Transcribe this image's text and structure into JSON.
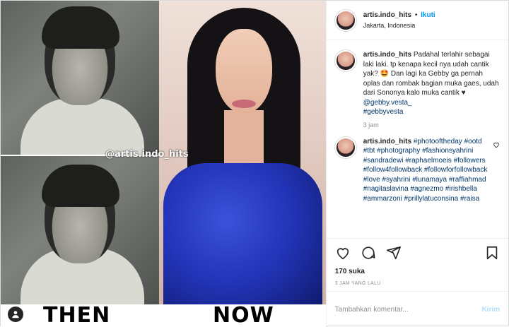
{
  "media": {
    "watermark": "@artis.indo_hits",
    "then_label": "THEN",
    "now_label": "NOW",
    "user_tag_icon": "person-icon"
  },
  "header": {
    "username": "artis.indo_hits",
    "separator": "•",
    "follow_label": "Ikuti",
    "location": "Jakarta, Indonesia"
  },
  "caption": {
    "username": "artis.indo_hits",
    "text": "Padahal terlahir sebagai laki laki. tp kenapa kecil nya udah cantik yak? 🤩 Dan lagi ka Gebby ga pernah oplas dan rombak bagian muka gaes, udah dari Sononya kalo muka cantik ♥ ",
    "mention": "@gebby.vesta_",
    "hashtag": "#gebbyvesta",
    "timestamp": "3 jam"
  },
  "hashtag_comment": {
    "username": "artis.indo_hits",
    "tags": "#photooftheday #ootd #tbt #photography #fashionsyahrini #sandradewi #raphaelmoeis #followers #follow4followback #followforfollowback #love #syahrini #lunamaya #raffiahmad #nagitaslavina #agnezmo #irishbella #ammarzoni #prillylatuconsina #raisa"
  },
  "engagement": {
    "likes": "170 suka",
    "time_ago": "3 JAM YANG LALU"
  },
  "comment_box": {
    "placeholder": "Tambahkan komentar...",
    "post_label": "Kirim"
  },
  "colors": {
    "link": "#00376b",
    "follow": "#0095f6",
    "post_disabled": "#b2dffc"
  }
}
